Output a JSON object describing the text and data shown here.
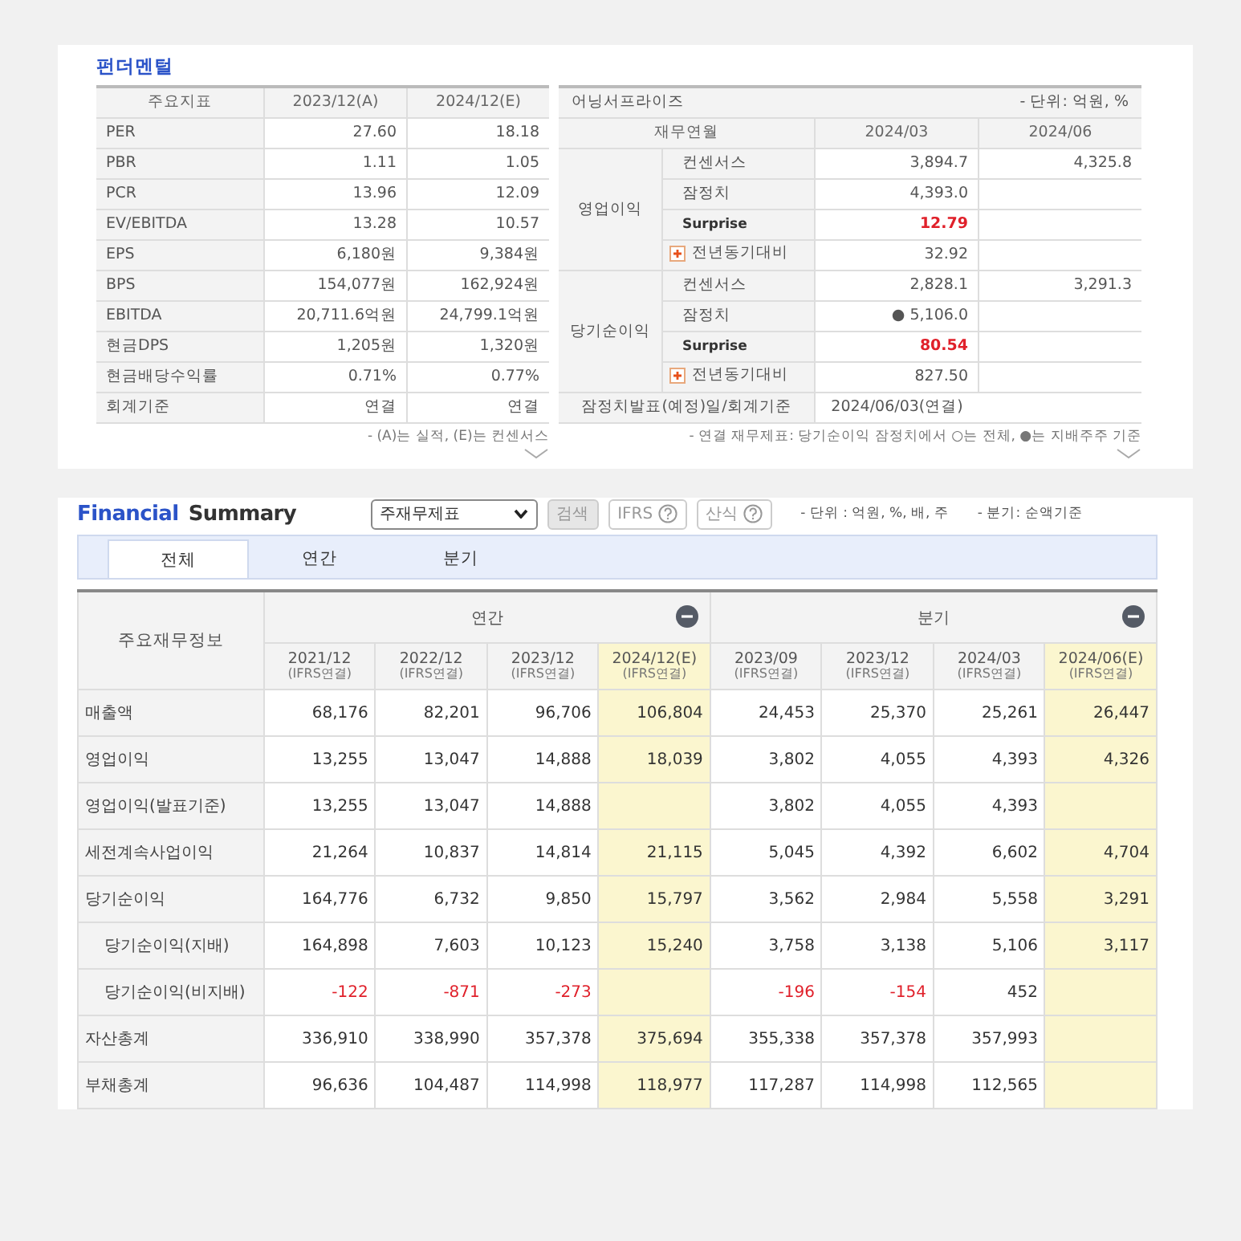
{
  "fundamentals": {
    "title": "펀더멘털",
    "columns": [
      "주요지표",
      "2023/12(A)",
      "2024/12(E)"
    ],
    "rows": [
      {
        "label": "PER",
        "values": [
          "27.60",
          "18.18"
        ]
      },
      {
        "label": "PBR",
        "values": [
          "1.11",
          "1.05"
        ]
      },
      {
        "label": "PCR",
        "values": [
          "13.96",
          "12.09"
        ]
      },
      {
        "label": "EV/EBITDA",
        "values": [
          "13.28",
          "10.57"
        ]
      },
      {
        "label": "EPS",
        "values": [
          "6,180원",
          "9,384원"
        ]
      },
      {
        "label": "BPS",
        "values": [
          "154,077원",
          "162,924원"
        ]
      },
      {
        "label": "EBITDA",
        "values": [
          "20,711.6억원",
          "24,799.1억원"
        ]
      },
      {
        "label": "현금DPS",
        "values": [
          "1,205원",
          "1,320원"
        ]
      },
      {
        "label": "현금배당수익률",
        "values": [
          "0.71%",
          "0.77%"
        ]
      },
      {
        "label": "회계기준",
        "values": [
          "연결",
          "연결"
        ]
      }
    ],
    "footnote": "- (A)는 실적, (E)는 컨센서스"
  },
  "earnings_surprise": {
    "title": "어닝서프라이즈",
    "unit": "- 단위: 억원, %",
    "columns": [
      "재무연월",
      "2024/03",
      "2024/06"
    ],
    "groups": [
      {
        "label": "영업이익",
        "rows": [
          {
            "kind": "plain",
            "label": "컨센서스",
            "values": [
              "3,894.7",
              "4,325.8"
            ]
          },
          {
            "kind": "plain",
            "label": "잠정치",
            "values": [
              "4,393.0"
            ]
          },
          {
            "kind": "surprise",
            "label": "Surprise",
            "values": [
              "12.79"
            ]
          },
          {
            "kind": "yoy",
            "label": "전년동기대비",
            "values": [
              "32.92"
            ]
          }
        ]
      },
      {
        "label": "당기순이익",
        "rows": [
          {
            "kind": "plain",
            "label": "컨센서스",
            "values": [
              "2,828.1",
              "3,291.3"
            ]
          },
          {
            "kind": "plain",
            "label": "잠정치",
            "values": [
              "● 5,106.0"
            ]
          },
          {
            "kind": "surprise",
            "label": "Surprise",
            "values": [
              "80.54"
            ]
          },
          {
            "kind": "yoy",
            "label": "전년동기대비",
            "values": [
              "827.50"
            ]
          }
        ]
      }
    ],
    "announce": {
      "label": "잠정치발표(예정)일/회계기준",
      "value": "2024/06/03(연결)"
    },
    "footnote": "- 연결 재무제표: 당기순이익 잠정치에서 ○는 전체, ●는 지배주주 기준"
  },
  "financial_summary": {
    "title_lead": "Financial",
    "title_rest": "Summary",
    "statement_select": "주재무제표",
    "search_button": "검색",
    "ifrs_button": "IFRS",
    "formula_button": "산식",
    "unit_note": "- 단위 : 억원, %, 배, 주",
    "quarter_note": "- 분기: 순액기준",
    "tabs": [
      {
        "label": "전체",
        "selected": true
      },
      {
        "label": "연간",
        "selected": false
      },
      {
        "label": "분기",
        "selected": false
      }
    ],
    "header": "주요재무정보",
    "groups": [
      {
        "label": "연간",
        "columns": [
          {
            "period": "2021/12",
            "basis": "(IFRS연결)",
            "estimate": false
          },
          {
            "period": "2022/12",
            "basis": "(IFRS연결)",
            "estimate": false
          },
          {
            "period": "2023/12",
            "basis": "(IFRS연결)",
            "estimate": false
          },
          {
            "period": "2024/12(E)",
            "basis": "(IFRS연결)",
            "estimate": true
          }
        ]
      },
      {
        "label": "분기",
        "columns": [
          {
            "period": "2023/09",
            "basis": "(IFRS연결)",
            "estimate": false
          },
          {
            "period": "2023/12",
            "basis": "(IFRS연결)",
            "estimate": false
          },
          {
            "period": "2024/03",
            "basis": "(IFRS연결)",
            "estimate": false
          },
          {
            "period": "2024/06(E)",
            "basis": "(IFRS연결)",
            "estimate": true
          }
        ]
      }
    ],
    "rows": [
      {
        "label": "매출액",
        "cells": [
          {
            "value": "68,176"
          },
          {
            "value": "82,201"
          },
          {
            "value": "96,706"
          },
          {
            "value": "106,804"
          },
          {
            "value": "24,453"
          },
          {
            "value": "25,370"
          },
          {
            "value": "25,261"
          },
          {
            "value": "26,447"
          }
        ]
      },
      {
        "label": "영업이익",
        "cells": [
          {
            "value": "13,255"
          },
          {
            "value": "13,047"
          },
          {
            "value": "14,888"
          },
          {
            "value": "18,039"
          },
          {
            "value": "3,802"
          },
          {
            "value": "4,055"
          },
          {
            "value": "4,393"
          },
          {
            "value": "4,326"
          }
        ]
      },
      {
        "label": "영업이익(발표기준)",
        "cells": [
          {
            "value": "13,255"
          },
          {
            "value": "13,047"
          },
          {
            "value": "14,888"
          },
          {},
          {
            "value": "3,802"
          },
          {
            "value": "4,055"
          },
          {
            "value": "4,393"
          },
          {}
        ]
      },
      {
        "label": "세전계속사업이익",
        "cells": [
          {
            "value": "21,264"
          },
          {
            "value": "10,837"
          },
          {
            "value": "14,814"
          },
          {
            "value": "21,115"
          },
          {
            "value": "5,045"
          },
          {
            "value": "4,392"
          },
          {
            "value": "6,602"
          },
          {
            "value": "4,704"
          }
        ]
      },
      {
        "label": "당기순이익",
        "cells": [
          {
            "value": "164,776"
          },
          {
            "value": "6,732"
          },
          {
            "value": "9,850"
          },
          {
            "value": "15,797"
          },
          {
            "value": "3,562"
          },
          {
            "value": "2,984"
          },
          {
            "value": "5,558"
          },
          {
            "value": "3,291"
          }
        ],
        "children": [
          {
            "label": "당기순이익(지배)",
            "cells": [
              {
                "value": "164,898"
              },
              {
                "value": "7,603"
              },
              {
                "value": "10,123"
              },
              {
                "value": "15,240"
              },
              {
                "value": "3,758"
              },
              {
                "value": "3,138"
              },
              {
                "value": "5,106"
              },
              {
                "value": "3,117"
              }
            ]
          },
          {
            "label": "당기순이익(비지배)",
            "cells": [
              {
                "value": "-122",
                "red": true
              },
              {
                "value": "-871",
                "red": true
              },
              {
                "value": "-273",
                "red": true
              },
              {},
              {
                "value": "-196",
                "red": true
              },
              {
                "value": "-154",
                "red": true
              },
              {
                "value": "452",
                "red": false
              },
              {}
            ]
          }
        ]
      },
      {
        "label": "자산총계",
        "cells": [
          {
            "value": "336,910"
          },
          {
            "value": "338,990"
          },
          {
            "value": "357,378"
          },
          {
            "value": "375,694"
          },
          {
            "value": "355,338"
          },
          {
            "value": "357,378"
          },
          {
            "value": "357,993"
          },
          {}
        ]
      },
      {
        "label": "부채총계",
        "cells": [
          {
            "value": "96,636"
          },
          {
            "value": "104,487"
          },
          {
            "value": "114,998"
          },
          {
            "value": "118,977"
          },
          {
            "value": "117,287"
          },
          {
            "value": "114,998"
          },
          {
            "value": "112,565"
          },
          {}
        ]
      }
    ]
  }
}
